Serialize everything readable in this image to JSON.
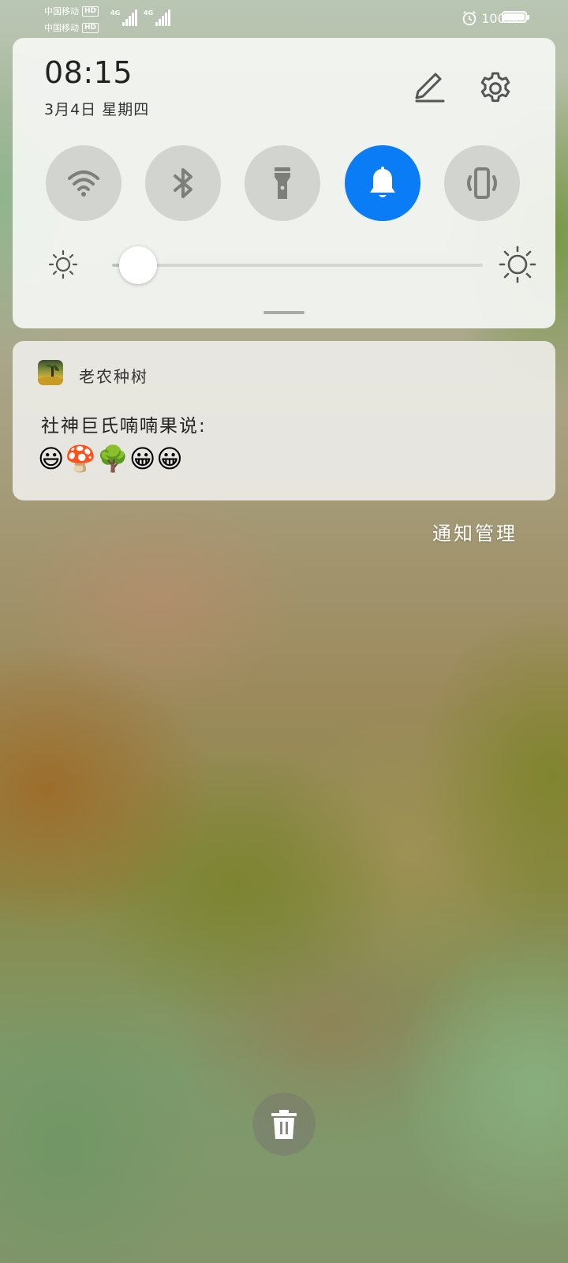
{
  "status_bar": {
    "carrier1": "中国移动",
    "carrier2": "中国移动",
    "hd1": "HD",
    "hd2": "HD",
    "net1": "4G",
    "net2": "4G",
    "battery_percent": "100%",
    "alarm_icon": "alarm-clock-icon",
    "battery_level": 1.0
  },
  "quick_settings": {
    "time": "08:15",
    "date": "3月4日 星期四",
    "edit_icon": "pencil-icon",
    "settings_icon": "gear-icon",
    "toggles": [
      {
        "icon": "wifi-icon",
        "active": false
      },
      {
        "icon": "bluetooth-icon",
        "active": false
      },
      {
        "icon": "flashlight-icon",
        "active": false
      },
      {
        "icon": "bell-icon",
        "active": true
      },
      {
        "icon": "vibrate-icon",
        "active": false
      }
    ],
    "active_color": "#0A7CF5",
    "brightness_level": 0.07
  },
  "notification": {
    "app_name": "老农种树",
    "title": "社神巨氏喃喃果说:",
    "body": "😃🍄🌳😀😀"
  },
  "notification_manage": "通知管理",
  "clear_icon": "trash-icon"
}
